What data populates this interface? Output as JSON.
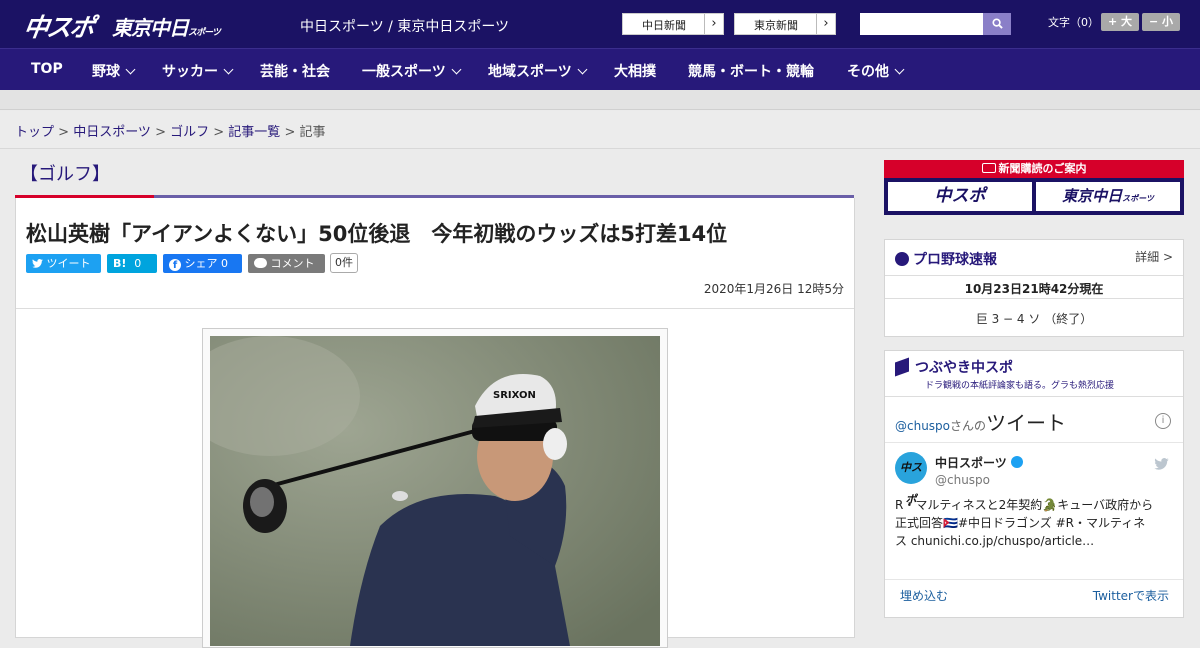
{
  "header": {
    "logo_chuspo": "中スポ",
    "logo_tokyo": "東京中日",
    "logo_tokyo_small": "スポーツ",
    "site_name": "中日スポーツ / 東京中日スポーツ",
    "paper_links": [
      {
        "label": "中日新聞"
      },
      {
        "label": "東京新聞"
      }
    ],
    "font_size_label": "文字（0）",
    "font_plus": "+ 大",
    "font_minus": "− 小"
  },
  "nav": {
    "items": [
      {
        "label": "TOP",
        "dropdown": false
      },
      {
        "label": "野球",
        "dropdown": true
      },
      {
        "label": "サッカー",
        "dropdown": true
      },
      {
        "label": "芸能・社会",
        "dropdown": false
      },
      {
        "label": "一般スポーツ",
        "dropdown": true
      },
      {
        "label": "地域スポーツ",
        "dropdown": true
      },
      {
        "label": "大相撲",
        "dropdown": false
      },
      {
        "label": "競馬・ボート・競輪",
        "dropdown": false
      },
      {
        "label": "その他",
        "dropdown": true
      }
    ]
  },
  "breadcrumb": [
    {
      "label": "トップ"
    },
    {
      "label": "中日スポーツ"
    },
    {
      "label": "ゴルフ"
    },
    {
      "label": "記事一覧"
    },
    {
      "label": "記事"
    }
  ],
  "article": {
    "category": "【ゴルフ】",
    "title": "松山英樹「アイアンよくない」50位後退　今年初戦のウッズは5打差14位",
    "share": {
      "tweet": "ツイート",
      "hatena": "B!",
      "hatena_count": "0",
      "facebook": "シェア",
      "facebook_count": "0",
      "comment": "コメント",
      "comment_count": "0件"
    },
    "date": "2020年1月26日 12時5分",
    "photo_cap_text": "SRIXON"
  },
  "sidebar": {
    "ad": {
      "top": "新聞購読のご案内",
      "left": "中スポ",
      "right": "東京中日",
      "right_small": "スポーツ"
    },
    "baseball": {
      "title": "プロ野球速報",
      "detail": "詳細 >",
      "time": "10月23日21時42分現在",
      "score": "巨 3 − 4 ソ （終了）"
    },
    "tsubuyaki": {
      "title": "つぶやき中スポ",
      "sub": "ドラ観戦の本紙評論家も語る。グラも熱烈応援",
      "handle_line": "@chuspo",
      "handle_suffix": "さんの",
      "tweets_word": "ツイート",
      "account_name": "中日スポーツ",
      "account_handle": "@chuspo",
      "tweet_text": "R・マルティネスと2年契約🐊キューバ政府から正式回答🇨🇺#中日ドラゴンズ #R・マルティネス chunichi.co.jp/chuspo/article…",
      "embed": "埋め込む",
      "view_on": "Twitterで表示"
    }
  },
  "colors": {
    "header": "#1b1264",
    "nav": "#27197a",
    "accent": "#d6002a",
    "twitter": "#1da1f2",
    "hatena": "#00a4de",
    "facebook": "#1877f2"
  }
}
